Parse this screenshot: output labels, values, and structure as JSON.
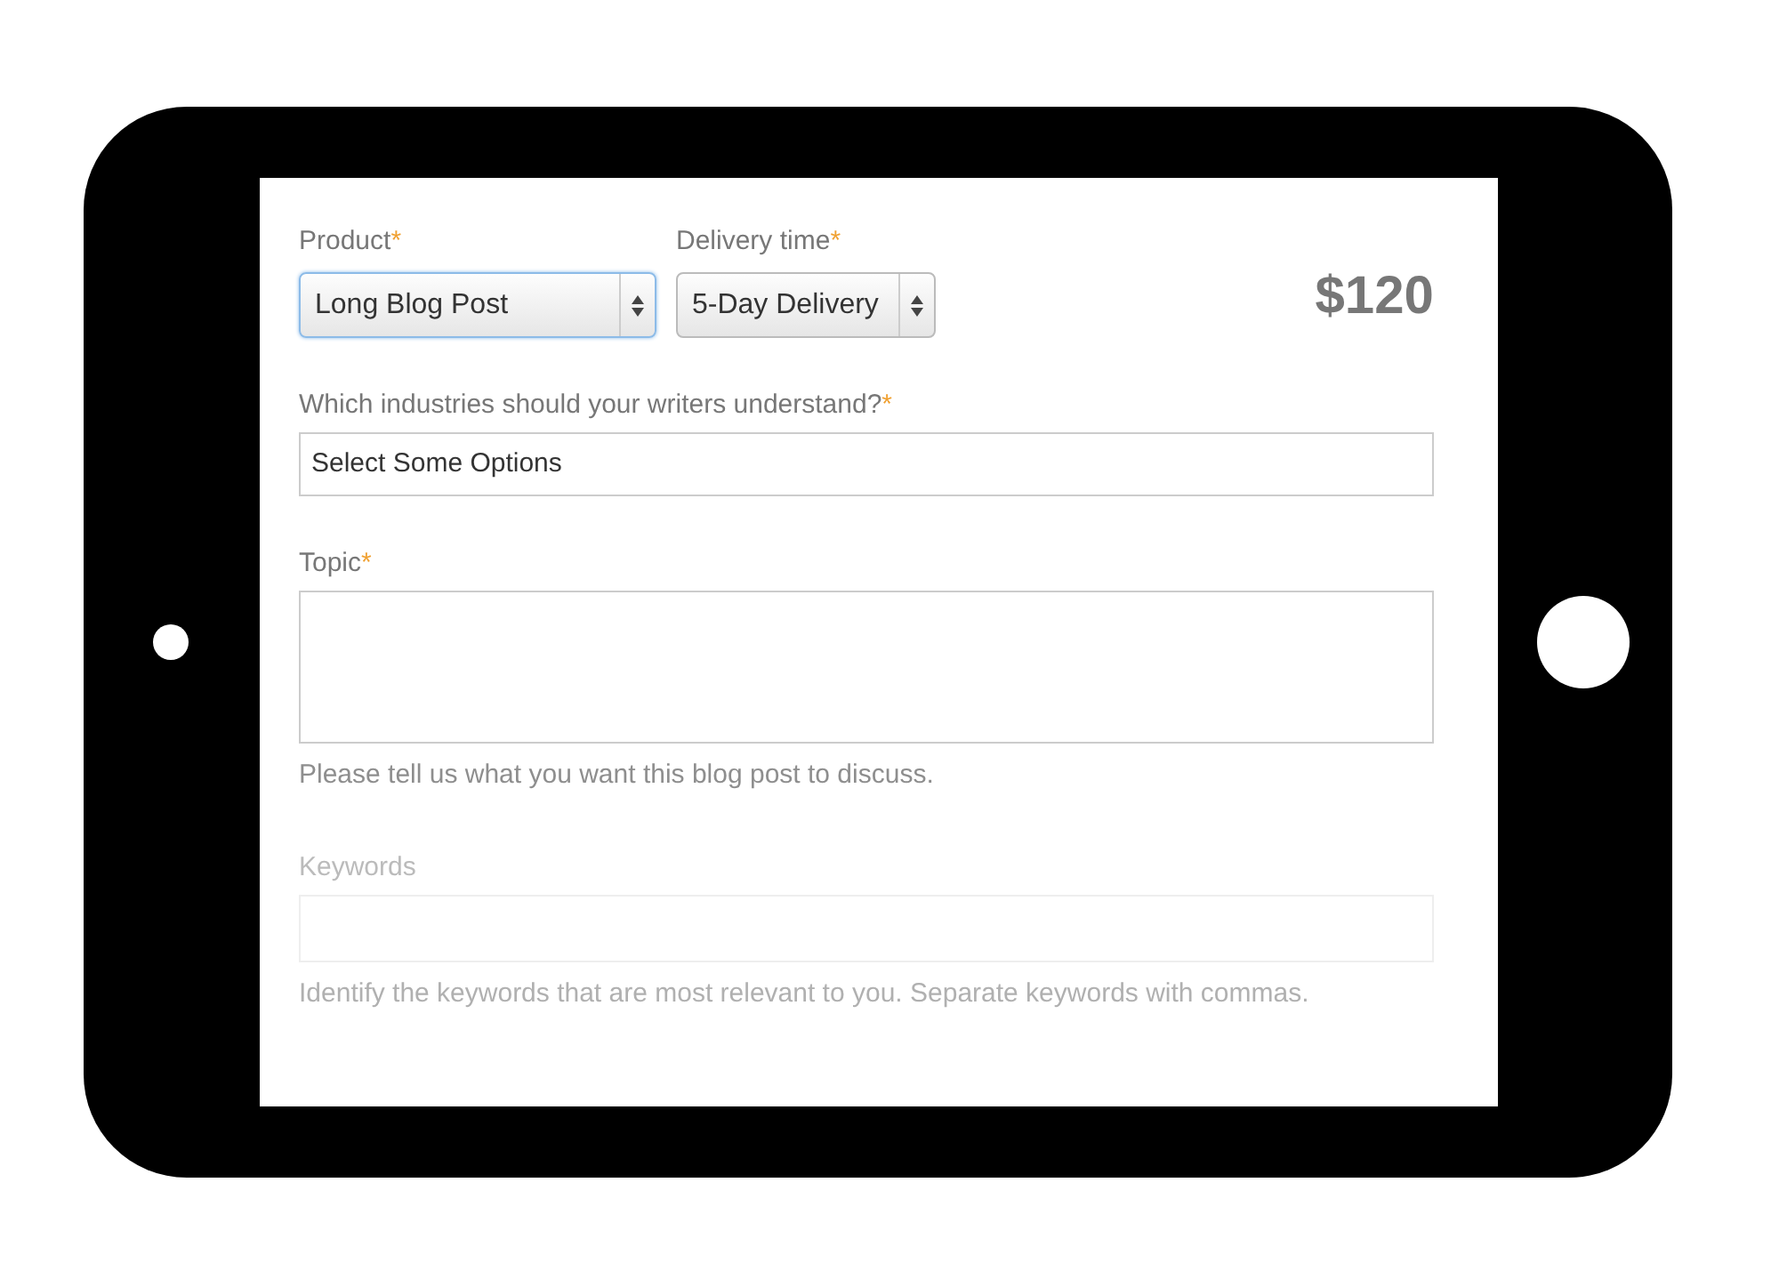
{
  "product": {
    "label": "Product",
    "mark": "*",
    "value": "Long Blog Post",
    "focused": true
  },
  "delivery": {
    "label": "Delivery time",
    "mark": "*",
    "value": "5-Day Delivery",
    "focused": false
  },
  "price": "$120",
  "fields": [
    {
      "kind": "select-box",
      "label": "Which industries should your writers understand?",
      "mark": "*",
      "value": "Select Some Options",
      "faded": false
    },
    {
      "kind": "textarea",
      "label": "Topic",
      "mark": "*",
      "hint": "Please tell us what you want this blog post to discuss.",
      "faded": false
    },
    {
      "kind": "text",
      "label": "Keywords",
      "hint": "Identify the keywords that are most relevant to you. Separate keywords with commas.",
      "faded": true
    }
  ]
}
